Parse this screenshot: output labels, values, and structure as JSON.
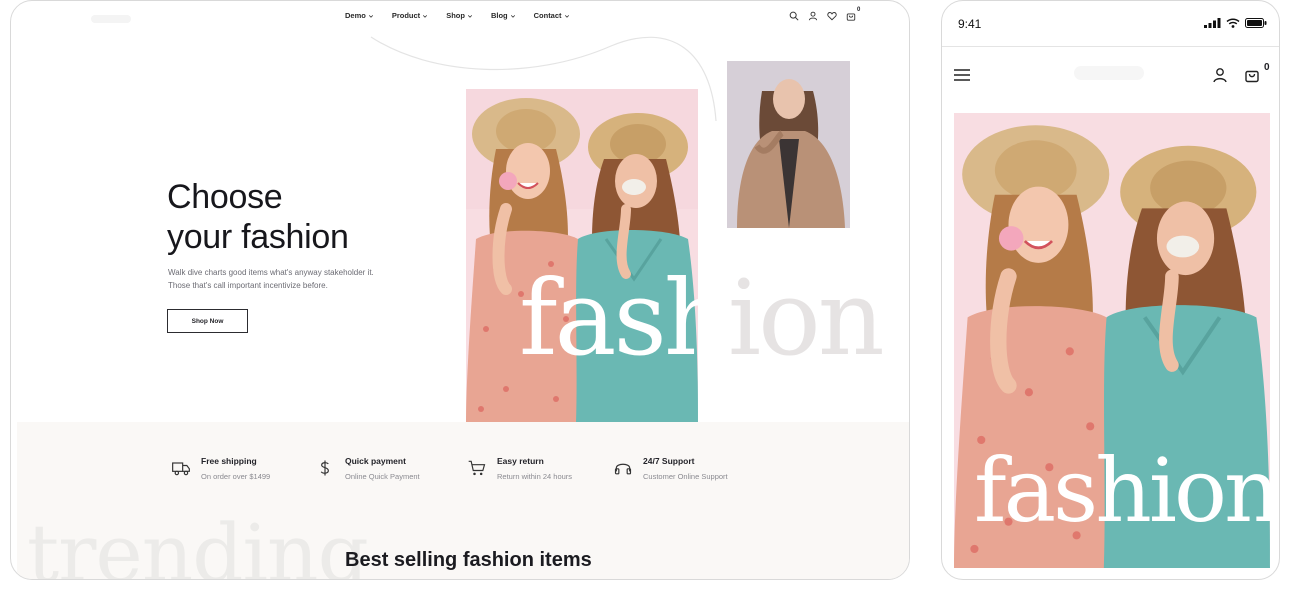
{
  "desktop": {
    "nav": {
      "menu": [
        {
          "label": "Demo"
        },
        {
          "label": "Product"
        },
        {
          "label": "Shop"
        },
        {
          "label": "Blog"
        },
        {
          "label": "Contact"
        }
      ],
      "cart_count": "0"
    },
    "hero": {
      "title_line1": "Choose",
      "title_line2": "your fashion",
      "description_line1": "Walk dive charts good items what's anyway stakeholder it.",
      "description_line2": "Those that's call important incentivize before.",
      "cta_label": "Shop Now",
      "watermark_part1": "fash",
      "watermark_part2": "ion"
    },
    "features": [
      {
        "title": "Free shipping",
        "subtitle": "On order over $1499",
        "icon": "truck-icon"
      },
      {
        "title": "Quick payment",
        "subtitle": "Online Quick Payment",
        "icon": "dollar-icon"
      },
      {
        "title": "Easy return",
        "subtitle": "Return within 24 hours",
        "icon": "cart-icon"
      },
      {
        "title": "24/7 Support",
        "subtitle": "Customer Online Support",
        "icon": "headphones-icon"
      }
    ],
    "trending_watermark": "trending",
    "section_title": "Best selling fashion items"
  },
  "mobile": {
    "status_time": "9:41",
    "cart_count": "0",
    "watermark": "fashion"
  },
  "colors": {
    "text_dark": "#17171c",
    "muted": "#6c6c74",
    "band_bg": "#faf8f6",
    "dress_teal": "#6ab8b3",
    "dress_floral": "#e8a593",
    "photo_pink": "#f7dbe0"
  }
}
